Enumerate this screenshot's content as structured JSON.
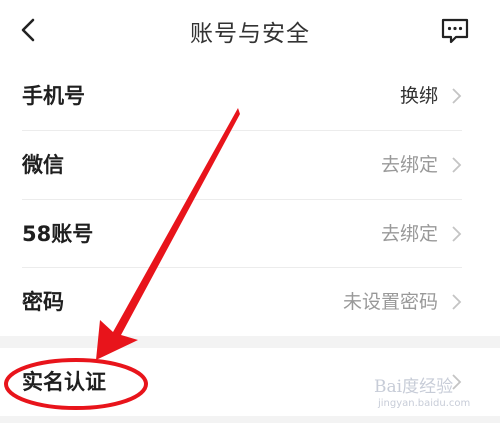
{
  "header": {
    "title": "账号与安全",
    "back_icon": "chevron-left-icon",
    "right_icon": "message-icon"
  },
  "rows": [
    {
      "label": "手机号",
      "value": "换绑",
      "value_color": "#333333"
    },
    {
      "label": "微信",
      "value": "去绑定",
      "value_color": "#999999"
    },
    {
      "label": "58账号",
      "value": "去绑定",
      "value_color": "#999999"
    },
    {
      "label": "密码",
      "value": "未设置密码",
      "value_color": "#999999"
    },
    {
      "label": "实名认证",
      "value": "",
      "value_color": "#999999"
    }
  ],
  "watermark": {
    "logo_text": "Bai度经验",
    "url": "jingyan.baidu.com"
  },
  "annotation": {
    "color": "#e8141b",
    "shapes": [
      "arrow",
      "ellipse"
    ]
  }
}
